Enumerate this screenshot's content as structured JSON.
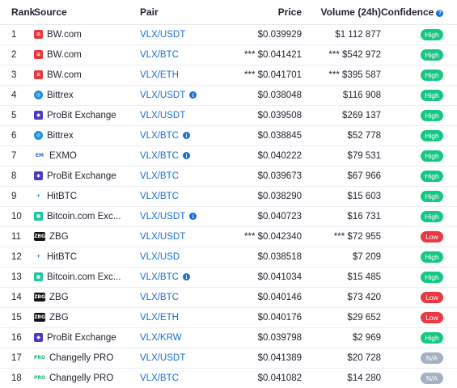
{
  "headers": {
    "rank": "Rank",
    "source": "Source",
    "pair": "Pair",
    "price": "Price",
    "volume": "Volume (24h)",
    "confidence": "Confidence"
  },
  "colors": {
    "high": "#16c784",
    "low": "#ea3943",
    "na": "#a6b0c3",
    "link": "#1b6fd3"
  },
  "rows": [
    {
      "rank": "1",
      "source": "BW.com",
      "icon": "bw-logo-icon",
      "pair": "VLX/USDT",
      "pair_info": false,
      "price": "$0.039929",
      "volume": "$1 112 877",
      "confidence": "High"
    },
    {
      "rank": "2",
      "source": "BW.com",
      "icon": "bw-logo-icon",
      "pair": "VLX/BTC",
      "pair_info": false,
      "price": "*** $0.041421",
      "volume": "*** $542 972",
      "confidence": "High"
    },
    {
      "rank": "3",
      "source": "BW.com",
      "icon": "bw-logo-icon",
      "pair": "VLX/ETH",
      "pair_info": false,
      "price": "*** $0.041701",
      "volume": "*** $395 587",
      "confidence": "High"
    },
    {
      "rank": "4",
      "source": "Bittrex",
      "icon": "bittrex-logo-icon",
      "pair": "VLX/USDT",
      "pair_info": true,
      "price": "$0.038048",
      "volume": "$116 908",
      "confidence": "High"
    },
    {
      "rank": "5",
      "source": "ProBit Exchange",
      "icon": "probit-logo-icon",
      "pair": "VLX/USDT",
      "pair_info": false,
      "price": "$0.039508",
      "volume": "$269 137",
      "confidence": "High"
    },
    {
      "rank": "6",
      "source": "Bittrex",
      "icon": "bittrex-logo-icon",
      "pair": "VLX/BTC",
      "pair_info": true,
      "price": "$0.038845",
      "volume": "$52 778",
      "confidence": "High"
    },
    {
      "rank": "7",
      "source": "EXMO",
      "icon": "exmo-logo-icon",
      "pair": "VLX/BTC",
      "pair_info": true,
      "price": "$0.040222",
      "volume": "$79 531",
      "confidence": "High"
    },
    {
      "rank": "8",
      "source": "ProBit Exchange",
      "icon": "probit-logo-icon",
      "pair": "VLX/BTC",
      "pair_info": false,
      "price": "$0.039673",
      "volume": "$67 966",
      "confidence": "High"
    },
    {
      "rank": "9",
      "source": "HitBTC",
      "icon": "hitbtc-logo-icon",
      "pair": "VLX/BTC",
      "pair_info": false,
      "price": "$0.038290",
      "volume": "$15 603",
      "confidence": "High"
    },
    {
      "rank": "10",
      "source": "Bitcoin.com Exc...",
      "icon": "bitcoincom-logo-icon",
      "pair": "VLX/USDT",
      "pair_info": true,
      "price": "$0.040723",
      "volume": "$16 731",
      "confidence": "High"
    },
    {
      "rank": "11",
      "source": "ZBG",
      "icon": "zbg-logo-icon",
      "pair": "VLX/USDT",
      "pair_info": false,
      "price": "*** $0.042340",
      "volume": "*** $72 955",
      "confidence": "Low"
    },
    {
      "rank": "12",
      "source": "HitBTC",
      "icon": "hitbtc-logo-icon",
      "pair": "VLX/USD",
      "pair_info": false,
      "price": "$0.038518",
      "volume": "$7 209",
      "confidence": "High"
    },
    {
      "rank": "13",
      "source": "Bitcoin.com Exc...",
      "icon": "bitcoincom-logo-icon",
      "pair": "VLX/BTC",
      "pair_info": true,
      "price": "$0.041034",
      "volume": "$15 485",
      "confidence": "High"
    },
    {
      "rank": "14",
      "source": "ZBG",
      "icon": "zbg-logo-icon",
      "pair": "VLX/BTC",
      "pair_info": false,
      "price": "$0.040146",
      "volume": "$73 420",
      "confidence": "Low"
    },
    {
      "rank": "15",
      "source": "ZBG",
      "icon": "zbg-logo-icon",
      "pair": "VLX/ETH",
      "pair_info": false,
      "price": "$0.040176",
      "volume": "$29 652",
      "confidence": "Low"
    },
    {
      "rank": "16",
      "source": "ProBit Exchange",
      "icon": "probit-logo-icon",
      "pair": "VLX/KRW",
      "pair_info": false,
      "price": "$0.039798",
      "volume": "$2 969",
      "confidence": "High"
    },
    {
      "rank": "17",
      "source": "Changelly PRO",
      "icon": "changelly-pro-logo-icon",
      "pair": "VLX/USDT",
      "pair_info": false,
      "price": "$0.041389",
      "volume": "$20 728",
      "confidence": "N/A"
    },
    {
      "rank": "18",
      "source": "Changelly PRO",
      "icon": "changelly-pro-logo-icon",
      "pair": "VLX/BTC",
      "pair_info": false,
      "price": "$0.041082",
      "volume": "$14 280",
      "confidence": "N/A"
    }
  ]
}
